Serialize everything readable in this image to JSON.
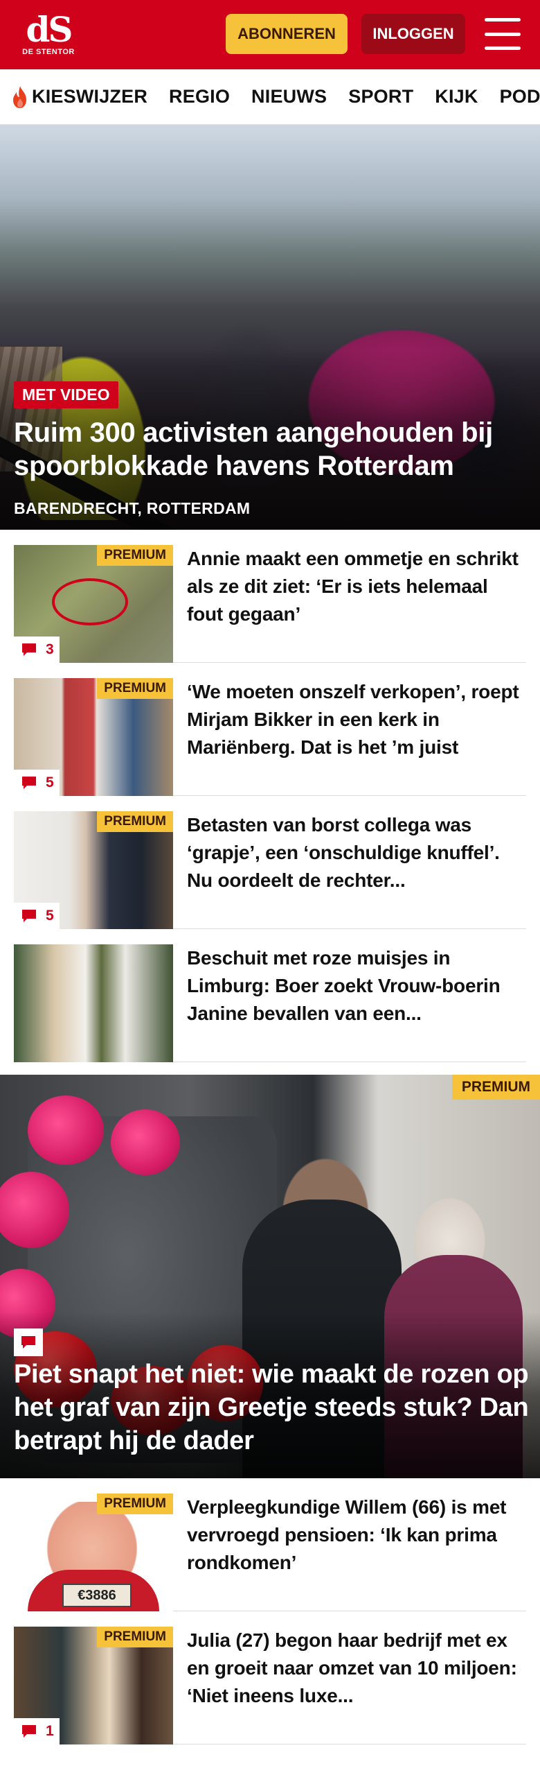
{
  "header": {
    "logo_mark": "dS",
    "logo_name": "DE STENTOR",
    "subscribe_label": "ABONNEREN",
    "login_label": "INLOGGEN"
  },
  "nav": {
    "items": [
      "KIESWIJZER",
      "REGIO",
      "NIEUWS",
      "SPORT",
      "KIJK",
      "PODCAST"
    ]
  },
  "hero": {
    "badge": "MET VIDEO",
    "title": "Ruim 300 activisten aangehouden bij spoorblokkade havens Rotterdam",
    "location": "BARENDRECHT, ROTTERDAM"
  },
  "articles": [
    {
      "premium": "PREMIUM",
      "comments": "3",
      "title": "Annie maakt een ommetje en schrikt als ze dit ziet: ‘Er is iets helemaal fout gegaan’"
    },
    {
      "premium": "PREMIUM",
      "comments": "5",
      "title": "‘We moeten onszelf verkopen’, roept Mirjam Bikker in een kerk in Mariënberg. Dat is het ’m juist"
    },
    {
      "premium": "PREMIUM",
      "comments": "5",
      "title": "Betasten van borst collega was ‘grapje’, een ‘onschuldige knuffel’. Nu oordeelt de rechter..."
    },
    {
      "title": "Beschuit met roze muisjes in Limburg: Boer zoekt Vrouw-boerin Janine bevallen van een..."
    }
  ],
  "feature": {
    "premium": "PREMIUM",
    "title": "Piet snapt het niet: wie maakt de rozen op het graf van zijn Greetje steeds stuk? Dan betrapt hij de dader"
  },
  "articles2": [
    {
      "premium": "PREMIUM",
      "title": "Verpleegkundige Willem (66) is met vervroegd pensioen: ‘Ik kan prima rondkomen’",
      "plate": "€3886"
    },
    {
      "premium": "PREMIUM",
      "comments": "1",
      "title": "Julia (27) begon haar bedrijf met ex en groeit naar omzet van 10 miljoen: ‘Niet ineens luxe..."
    }
  ],
  "colors": {
    "brand_red": "#d0021b",
    "premium_yellow": "#f5c23a",
    "login_dark_red": "#9b0a16"
  },
  "icons": [
    "menu-icon",
    "flame-icon",
    "comment-icon"
  ]
}
